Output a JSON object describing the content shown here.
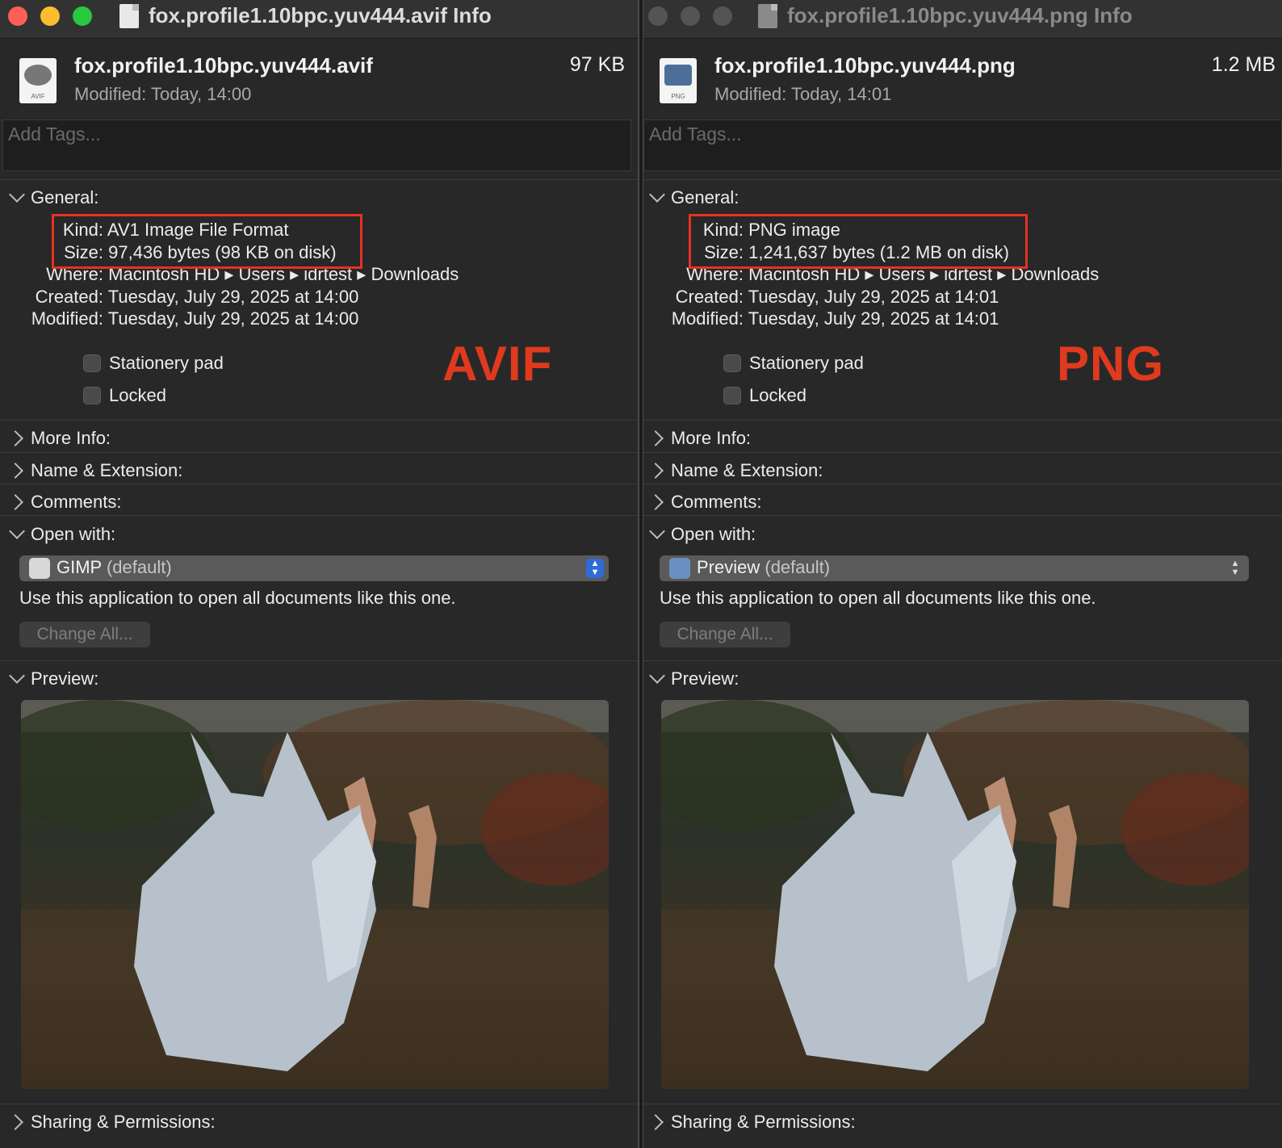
{
  "windows": [
    {
      "title": "fox.profile1.10bpc.yuv444.avif Info",
      "active": true,
      "file": {
        "name": "fox.profile1.10bpc.yuv444.avif",
        "size": "97 KB",
        "modified": "Modified:  Today, 14:00",
        "icon_ext": "AVIF"
      },
      "tags_placeholder": "Add Tags...",
      "general": {
        "label": "General:",
        "kind_key": "Kind:",
        "kind_val": "AV1 Image File Format",
        "size_key": "Size:",
        "size_val": "97,436 bytes (98 KB on disk)",
        "where_key": "Where:",
        "where_val": "Macintosh HD ▸ Users ▸ idrtest ▸ Downloads",
        "created_key": "Created:",
        "created_val": "Tuesday, July 29, 2025 at 14:00",
        "modified_key": "Modified:",
        "modified_val": "Tuesday, July 29, 2025 at 14:00",
        "stationery": "Stationery pad",
        "locked": "Locked",
        "annotation": "AVIF"
      },
      "sections": {
        "more_info": "More Info:",
        "name_ext": "Name & Extension:",
        "comments": "Comments:",
        "open_with": "Open with:",
        "preview": "Preview:",
        "sharing": "Sharing & Permissions:"
      },
      "open_with": {
        "app": "GIMP",
        "default": "(default)",
        "use_text": "Use this application to open all documents like this one.",
        "change_all": "Change All..."
      },
      "icons": {
        "file": "gimp-document-icon",
        "app": "gimp-app-icon"
      }
    },
    {
      "title": "fox.profile1.10bpc.yuv444.png Info",
      "active": false,
      "file": {
        "name": "fox.profile1.10bpc.yuv444.png",
        "size": "1.2 MB",
        "modified": "Modified:  Today, 14:01",
        "icon_ext": "PNG"
      },
      "tags_placeholder": "Add Tags...",
      "general": {
        "label": "General:",
        "kind_key": "Kind:",
        "kind_val": "PNG image",
        "size_key": "Size:",
        "size_val": "1,241,637 bytes (1.2 MB on disk)",
        "where_key": "Where:",
        "where_val": "Macintosh HD ▸ Users ▸ idrtest ▸ Downloads",
        "created_key": "Created:",
        "created_val": "Tuesday, July 29, 2025 at 14:01",
        "modified_key": "Modified:",
        "modified_val": "Tuesday, July 29, 2025 at 14:01",
        "stationery": "Stationery pad",
        "locked": "Locked",
        "annotation": "PNG"
      },
      "sections": {
        "more_info": "More Info:",
        "name_ext": "Name & Extension:",
        "comments": "Comments:",
        "open_with": "Open with:",
        "preview": "Preview:",
        "sharing": "Sharing & Permissions:"
      },
      "open_with": {
        "app": "Preview",
        "default": "(default)",
        "use_text": "Use this application to open all documents like this one.",
        "change_all": "Change All..."
      },
      "icons": {
        "file": "preview-document-icon",
        "app": "preview-app-icon"
      }
    }
  ],
  "colors": {
    "window_bg": "#282828",
    "annotation_red": "#e53222",
    "close": "#fe5f57",
    "minimize": "#febc2e",
    "zoom": "#28c840"
  }
}
